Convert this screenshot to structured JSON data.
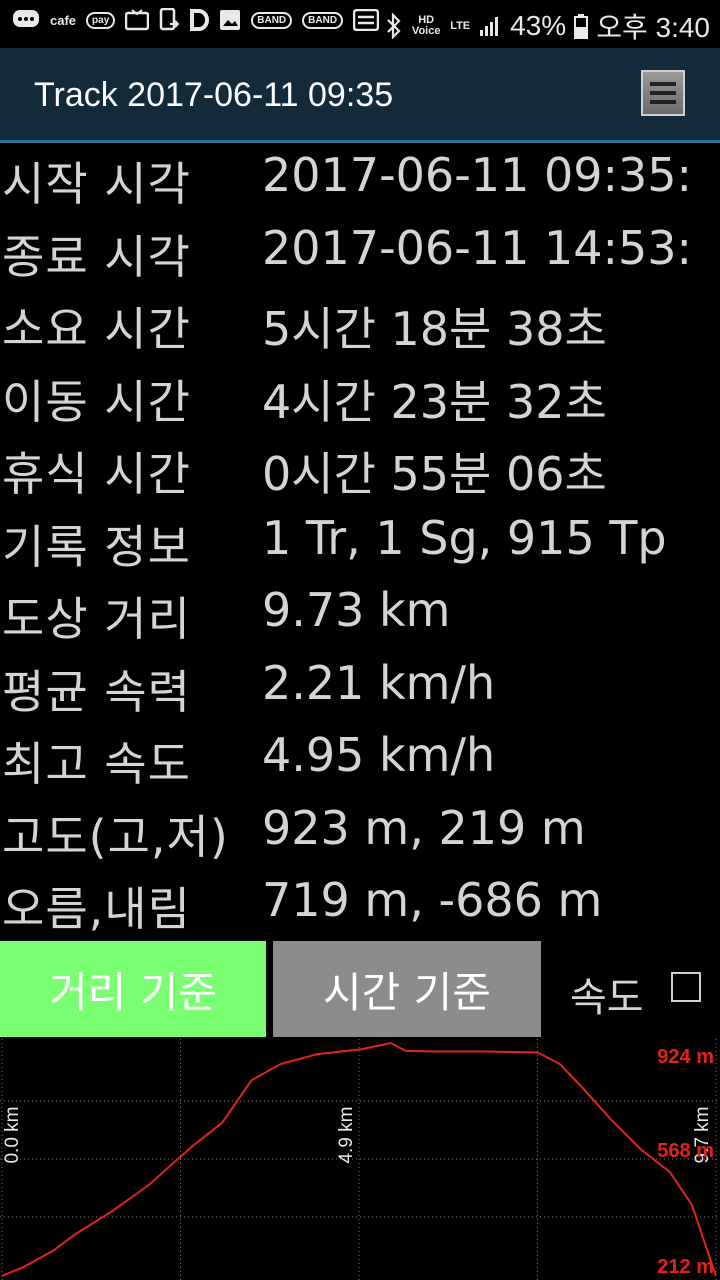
{
  "status_bar": {
    "left_items": [
      "cafe",
      "pay",
      "BAND",
      "BAND"
    ],
    "hd_voice": "HD Voice",
    "lte": "LTE",
    "battery": "43%",
    "time": "오후 3:40"
  },
  "app_bar": {
    "title": "Track 2017-06-11 09:35"
  },
  "info": {
    "rows": [
      {
        "label": "시작 시각",
        "value": "2017-06-11 09:35:"
      },
      {
        "label": "종료 시각",
        "value": "2017-06-11 14:53:"
      },
      {
        "label": "소요 시간",
        "value": "5시간 18분 38초"
      },
      {
        "label": "이동 시간",
        "value": "4시간 23분 32초"
      },
      {
        "label": "휴식 시간",
        "value": "0시간 55분 06초"
      },
      {
        "label": "기록 정보",
        "value": "1 Tr, 1 Sg, 915 Tp"
      },
      {
        "label": "도상 거리",
        "value": "9.73 km"
      },
      {
        "label": "평균 속력",
        "value": "2.21 km/h"
      },
      {
        "label": "최고 속도",
        "value": "4.95 km/h"
      },
      {
        "label": "고도(고,저)",
        "value": "923 m, 219 m"
      },
      {
        "label": "오름,내림",
        "value": "719 m, -686 m"
      }
    ]
  },
  "buttons": {
    "distance": "거리 기준",
    "time": "시간 기준",
    "speed": "속도"
  },
  "colors": {
    "profile_line": "#e0241c",
    "distance_active": "#7bff72",
    "time_inactive": "#8c8c8c"
  },
  "chart_data": {
    "type": "line",
    "x_labels": [
      "0.0 km",
      "4.9 km",
      "9.7 km"
    ],
    "y_labels": [
      "924 m",
      "568 m",
      "212 m"
    ],
    "xlim": [
      0,
      9.73
    ],
    "ylim": [
      212,
      924
    ],
    "grid": true,
    "series": [
      {
        "x": [
          0,
          0.3,
          0.7,
          1.0,
          1.5,
          2.0,
          2.3,
          2.6,
          3.0,
          3.4,
          3.8,
          4.3,
          4.9,
          5.3,
          5.5,
          5.9,
          6.6,
          7.3,
          7.6,
          7.9,
          8.3,
          8.7,
          9.1,
          9.4,
          9.73
        ],
        "y": [
          212,
          240,
          290,
          340,
          410,
          490,
          550,
          610,
          680,
          810,
          860,
          890,
          905,
          924,
          900,
          898,
          898,
          895,
          860,
          790,
          690,
          600,
          530,
          430,
          212
        ]
      }
    ]
  }
}
